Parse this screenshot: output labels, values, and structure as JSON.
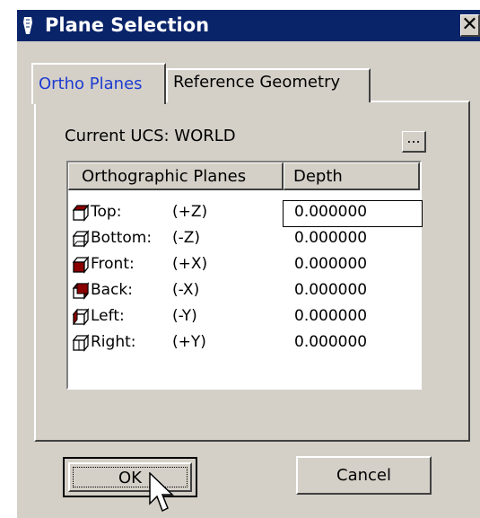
{
  "window": {
    "title": "Plane Selection",
    "close_glyph": "✕",
    "app_icon": "pen-nib-icon"
  },
  "tabs": [
    {
      "label": "Ortho Planes",
      "active": true
    },
    {
      "label": "Reference Geometry",
      "active": false
    }
  ],
  "ucs": {
    "label": "Current UCS: WORLD",
    "browse_label": "..."
  },
  "table": {
    "columns": [
      "Orthographic Planes",
      "Depth"
    ],
    "rows": [
      {
        "name": "Top:",
        "axis": "(+Z)",
        "depth": "0.000000",
        "icon": "cube-top-icon"
      },
      {
        "name": "Bottom:",
        "axis": "(-Z)",
        "depth": "0.000000",
        "icon": "cube-bottom-icon"
      },
      {
        "name": "Front:",
        "axis": "(+X)",
        "depth": "0.000000",
        "icon": "cube-front-icon"
      },
      {
        "name": "Back:",
        "axis": "(-X)",
        "depth": "0.000000",
        "icon": "cube-back-icon"
      },
      {
        "name": "Left:",
        "axis": "(-Y)",
        "depth": "0.000000",
        "icon": "cube-left-icon"
      },
      {
        "name": "Right:",
        "axis": "(+Y)",
        "depth": "0.000000",
        "icon": "cube-right-icon"
      }
    ]
  },
  "buttons": {
    "ok": "OK",
    "cancel": "Cancel"
  },
  "colors": {
    "titlebar": "#0a246a",
    "face": "#d4d0c8",
    "active_tab_text": "#1d3bd1",
    "cube_highlight": "#8b0000"
  }
}
